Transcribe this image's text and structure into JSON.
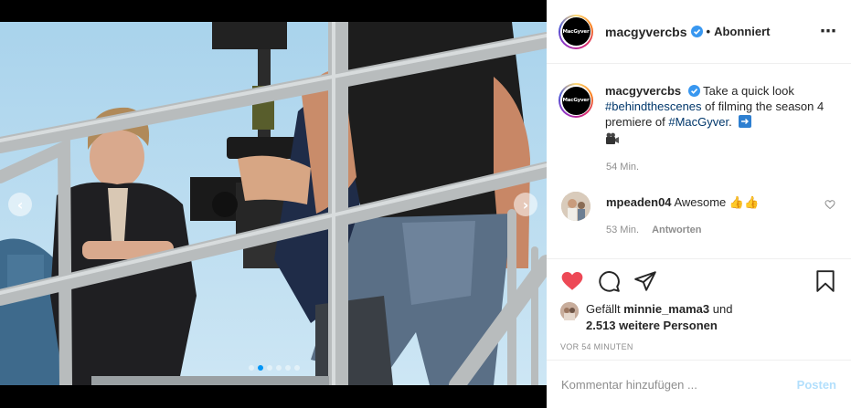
{
  "header": {
    "avatar_text": "MacGyver",
    "username": "macgyvercbs",
    "separator": "•",
    "follow_state": "Abonniert",
    "more_icon": "⋯"
  },
  "caption": {
    "username": "macgyvercbs",
    "text_before": " Take a quick look ",
    "hashtag1": "#behindthescenes",
    "text_middle": " of filming the season 4 premiere of ",
    "hashtag2": "#MacGyver",
    "text_end": ".",
    "time": "54 Min."
  },
  "comments": [
    {
      "username": "mpeaden04",
      "text": " Awesome 👍👍",
      "time": "53 Min.",
      "reply_label": "Antworten"
    }
  ],
  "actions": {
    "like_icon": "heart-filled",
    "comment_icon": "comment-bubble",
    "share_icon": "paper-plane",
    "save_icon": "bookmark",
    "like_color": "#ed4956"
  },
  "likes": {
    "prefix": "Gefällt ",
    "user": "minnie_mama3",
    "middle": " und",
    "others": "2.513 weitere Personen"
  },
  "timestamp": "VOR 54 MINUTEN",
  "comment_box": {
    "placeholder": "Kommentar hinzufügen ...",
    "post_label": "Posten"
  },
  "media": {
    "prev_arrow": "‹",
    "next_arrow": "›"
  }
}
